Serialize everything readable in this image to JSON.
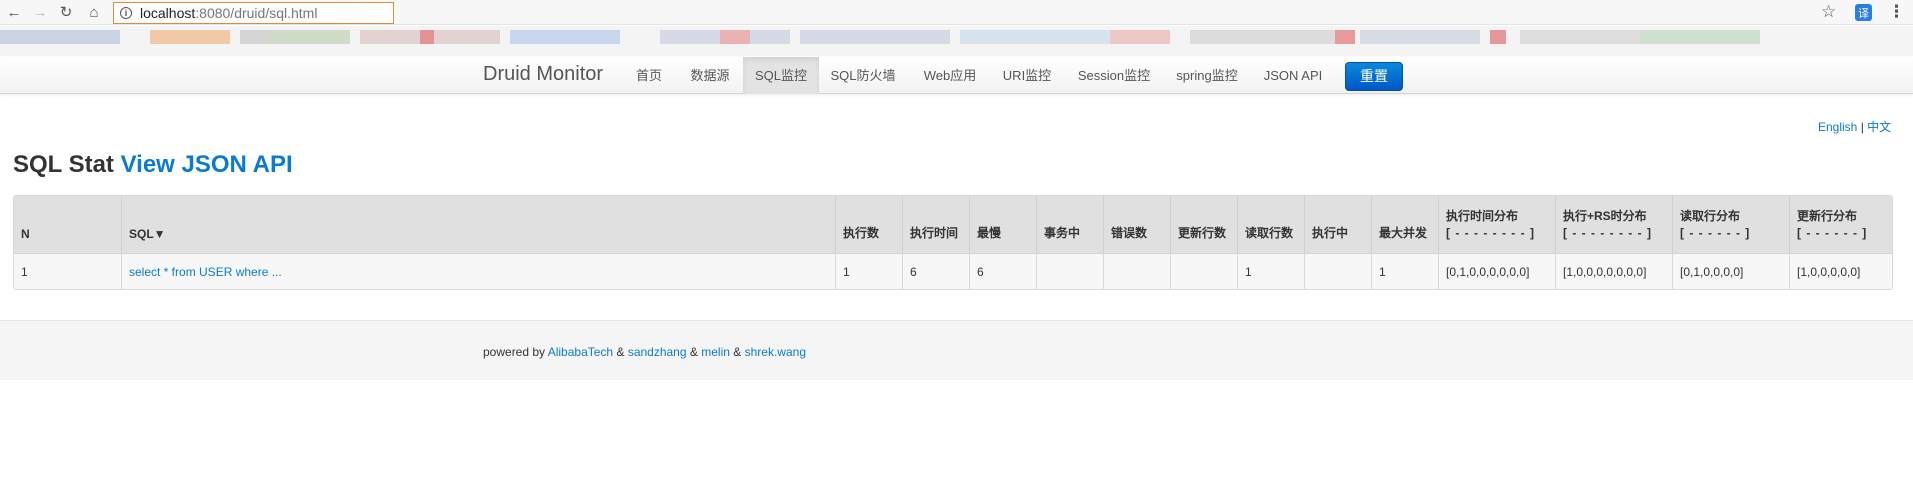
{
  "browser": {
    "url_host": "localhost",
    "url_rest": ":8080/druid/sql.html",
    "translate_label": "译"
  },
  "navbar": {
    "brand": "Druid Monitor",
    "items": [
      {
        "label": "首页"
      },
      {
        "label": "数据源"
      },
      {
        "label": "SQL监控"
      },
      {
        "label": "SQL防火墙"
      },
      {
        "label": "Web应用"
      },
      {
        "label": "URI监控"
      },
      {
        "label": "Session监控"
      },
      {
        "label": "spring监控"
      },
      {
        "label": "JSON API"
      }
    ],
    "active_index": 2,
    "reset_label": "重置"
  },
  "lang": {
    "english": "English",
    "separator": "|",
    "chinese": "中文"
  },
  "heading": {
    "title": "SQL Stat",
    "link": "View JSON API"
  },
  "table": {
    "headers": [
      {
        "line1": "N"
      },
      {
        "line1": "SQL▼"
      },
      {
        "line1": "执行数"
      },
      {
        "line1": "执行时间"
      },
      {
        "line1": "最慢"
      },
      {
        "line1": "事务中"
      },
      {
        "line1": "错误数"
      },
      {
        "line1": "更新行数"
      },
      {
        "line1": "读取行数"
      },
      {
        "line1": "执行中"
      },
      {
        "line1": "最大并发"
      },
      {
        "line1": "执行时间分布",
        "line2": "[ - - - - - - - - ]"
      },
      {
        "line1": "执行+RS时分布",
        "line2": "[ - - - - - - - - ]"
      },
      {
        "line1": "读取行分布",
        "line2": "[ - - - - - - ]"
      },
      {
        "line1": "更新行分布",
        "line2": "[ - - - - - - ]"
      }
    ],
    "rows": [
      {
        "n": "1",
        "sql": "select * from USER where ...",
        "exec_count": "1",
        "exec_time": "6",
        "slowest": "6",
        "in_tx": "",
        "errors": "",
        "update_rows": "",
        "read_rows": "1",
        "running": "",
        "max_concurrent": "1",
        "exec_hist": "[0,1,0,0,0,0,0,0]",
        "exec_rs_hist": "[1,0,0,0,0,0,0,0]",
        "read_hist": "[0,1,0,0,0,0]",
        "update_hist": "[1,0,0,0,0,0]"
      }
    ]
  },
  "footer": {
    "prefix": "powered by",
    "links": [
      "AlibabaTech",
      "sandzhang",
      "melin",
      "shrek.wang"
    ],
    "separator": "&"
  },
  "colors": {
    "link": "#0a7bd0",
    "reset_button": "#0668d4"
  }
}
